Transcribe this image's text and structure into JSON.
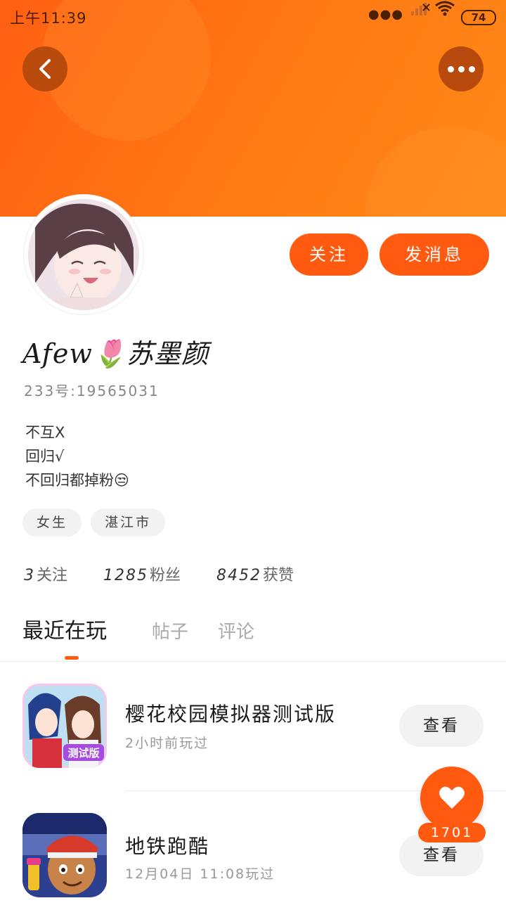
{
  "status_bar": {
    "time": "上午11:39",
    "battery": "74",
    "icons": [
      "more-dots-icon",
      "signal-icon",
      "wifi-icon",
      "battery-icon"
    ]
  },
  "header": {
    "color": "#ff6a12",
    "back_icon": "chevron-left-icon",
    "more_icon": "more-horizontal-icon"
  },
  "profile": {
    "username": "Afew🌷苏墨颜",
    "uid": "233号:19565031",
    "bio": [
      "不互X",
      "回归√",
      "不回归都掉粉😒"
    ],
    "tags": [
      "女生",
      "湛江市"
    ],
    "stats": [
      {
        "num": "3",
        "label": "关注"
      },
      {
        "num": "1285",
        "label": "粉丝"
      },
      {
        "num": "8452",
        "label": "获赞"
      }
    ]
  },
  "actions": {
    "follow_label": "关注",
    "message_label": "发消息"
  },
  "tabs": {
    "items": [
      "最近在玩",
      "帖子",
      "评论"
    ],
    "active": "最近在玩"
  },
  "games": [
    {
      "title": "樱花校园模拟器测试版",
      "subtitle": "2小时前玩过",
      "button": "查看",
      "badge": "测试版"
    },
    {
      "title": "地铁跑酷",
      "subtitle": "12月04日 11:08玩过",
      "button": "查看"
    }
  ],
  "like": {
    "count": "1701",
    "icon": "heart-icon"
  },
  "accent_color": "#ff5a10"
}
